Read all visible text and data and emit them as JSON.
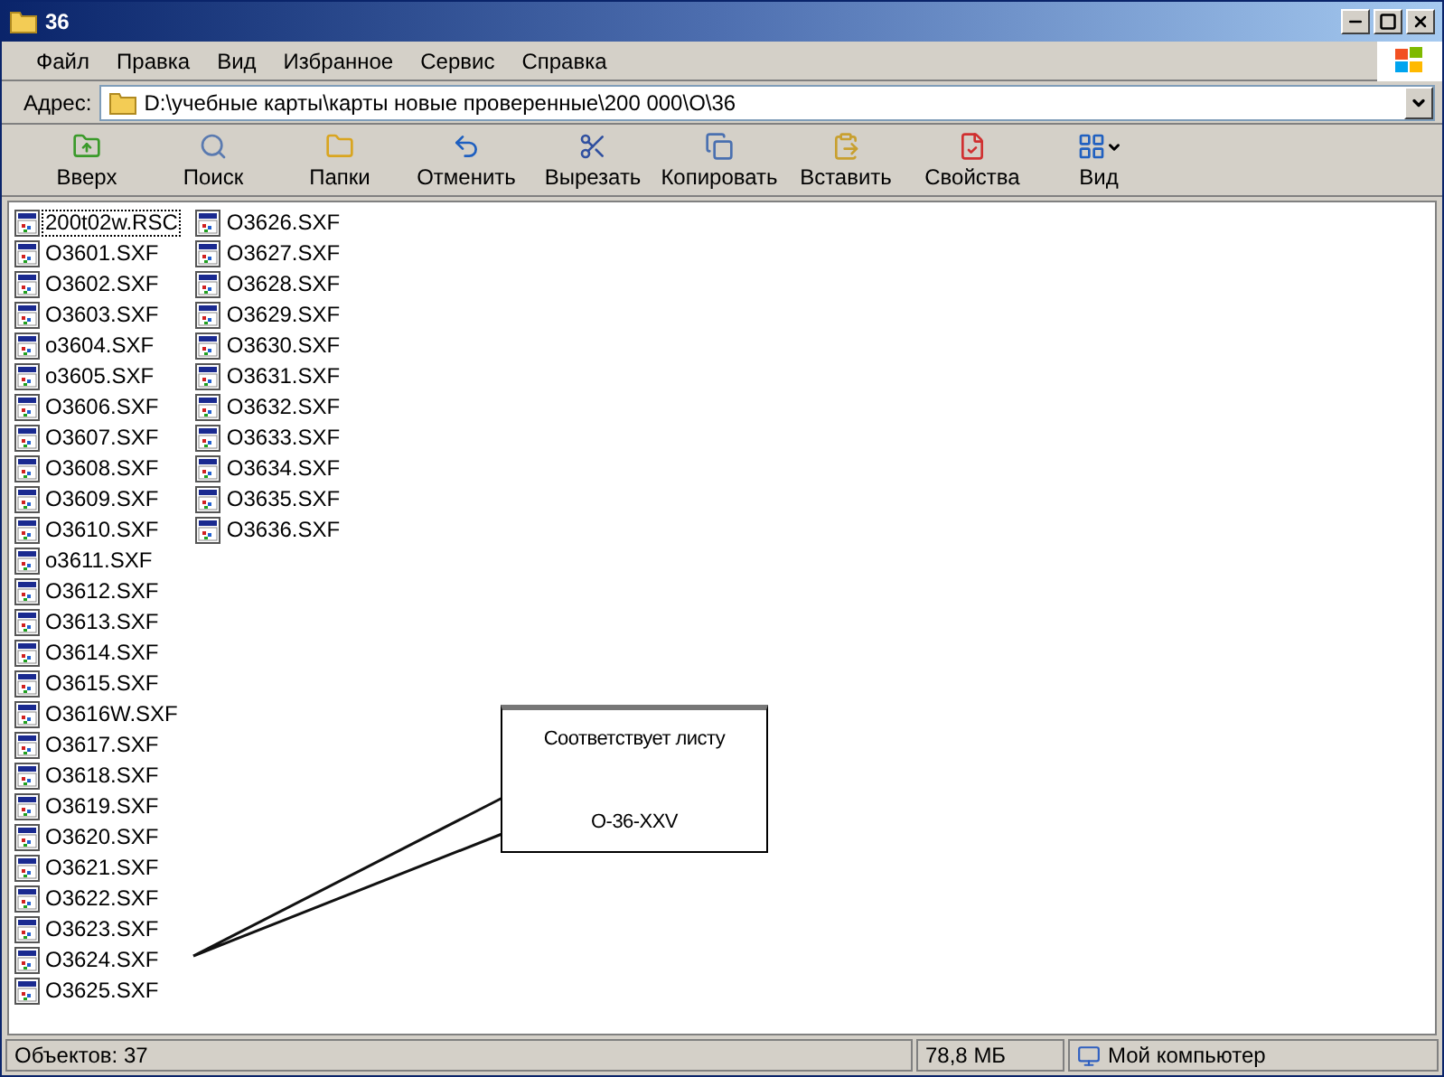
{
  "window": {
    "title": "36"
  },
  "menu": [
    "Файл",
    "Правка",
    "Вид",
    "Избранное",
    "Сервис",
    "Справка"
  ],
  "address": {
    "label": "Адрес:",
    "value": "D:\\учебные карты\\карты новые проверенные\\200 000\\O\\36"
  },
  "toolbar": [
    {
      "kind": "up",
      "label": "Вверх"
    },
    {
      "kind": "search",
      "label": "Поиск"
    },
    {
      "kind": "folders",
      "label": "Папки"
    },
    {
      "kind": "undo",
      "label": "Отменить"
    },
    {
      "kind": "cut",
      "label": "Вырезать"
    },
    {
      "kind": "copy",
      "label": "Копировать"
    },
    {
      "kind": "paste",
      "label": "Вставить"
    },
    {
      "kind": "properties",
      "label": "Свойства"
    },
    {
      "kind": "view",
      "label": "Вид"
    }
  ],
  "files": [
    {
      "name": "200t02w.RSC",
      "focused": true
    },
    {
      "name": "O3601.SXF",
      "focused": false
    },
    {
      "name": "O3602.SXF",
      "focused": false
    },
    {
      "name": "O3603.SXF",
      "focused": false
    },
    {
      "name": "o3604.SXF",
      "focused": false
    },
    {
      "name": "o3605.SXF",
      "focused": false
    },
    {
      "name": "O3606.SXF",
      "focused": false
    },
    {
      "name": "O3607.SXF",
      "focused": false
    },
    {
      "name": "O3608.SXF",
      "focused": false
    },
    {
      "name": "O3609.SXF",
      "focused": false
    },
    {
      "name": "O3610.SXF",
      "focused": false
    },
    {
      "name": "o3611.SXF",
      "focused": false
    },
    {
      "name": "O3612.SXF",
      "focused": false
    },
    {
      "name": "O3613.SXF",
      "focused": false
    },
    {
      "name": "O3614.SXF",
      "focused": false
    },
    {
      "name": "O3615.SXF",
      "focused": false
    },
    {
      "name": "O3616W.SXF",
      "focused": false
    },
    {
      "name": "O3617.SXF",
      "focused": false
    },
    {
      "name": "O3618.SXF",
      "focused": false
    },
    {
      "name": "O3619.SXF",
      "focused": false
    },
    {
      "name": "O3620.SXF",
      "focused": false
    },
    {
      "name": "O3621.SXF",
      "focused": false
    },
    {
      "name": "O3622.SXF",
      "focused": false
    },
    {
      "name": "O3623.SXF",
      "focused": false
    },
    {
      "name": "O3624.SXF",
      "focused": false
    },
    {
      "name": "O3625.SXF",
      "focused": false
    },
    {
      "name": "O3626.SXF",
      "focused": false
    },
    {
      "name": "O3627.SXF",
      "focused": false
    },
    {
      "name": "O3628.SXF",
      "focused": false
    },
    {
      "name": "O3629.SXF",
      "focused": false
    },
    {
      "name": "O3630.SXF",
      "focused": false
    },
    {
      "name": "O3631.SXF",
      "focused": false
    },
    {
      "name": "O3632.SXF",
      "focused": false
    },
    {
      "name": "O3633.SXF",
      "focused": false
    },
    {
      "name": "O3634.SXF",
      "focused": false
    },
    {
      "name": "O3635.SXF",
      "focused": false
    },
    {
      "name": "O3636.SXF",
      "focused": false
    }
  ],
  "callout": {
    "lines": [
      "Соответствует листу",
      "O-36-XXV"
    ]
  },
  "status_bar": {
    "objects": "Объектов: 37",
    "size": "78,8 МБ",
    "zone": "Мой компьютер"
  }
}
